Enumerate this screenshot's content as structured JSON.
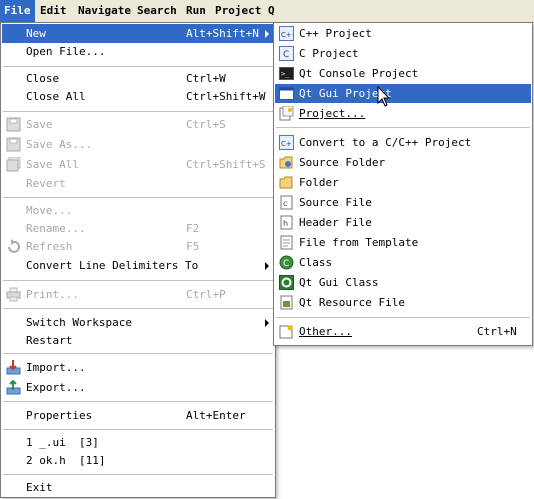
{
  "menubar": {
    "items": [
      {
        "label": "File"
      },
      {
        "label": "Edit"
      },
      {
        "label": "Navigate"
      },
      {
        "label": "Search"
      },
      {
        "label": "Run"
      },
      {
        "label": "Project"
      },
      {
        "label": "Q"
      }
    ]
  },
  "file_menu": {
    "new": {
      "label": "New",
      "accel": "Alt+Shift+N"
    },
    "open_file": {
      "label": "Open File..."
    },
    "close": {
      "label": "Close",
      "accel": "Ctrl+W"
    },
    "close_all": {
      "label": "Close All",
      "accel": "Ctrl+Shift+W"
    },
    "save": {
      "label": "Save",
      "accel": "Ctrl+S"
    },
    "save_as": {
      "label": "Save As..."
    },
    "save_all": {
      "label": "Save All",
      "accel": "Ctrl+Shift+S"
    },
    "revert": {
      "label": "Revert"
    },
    "move": {
      "label": "Move..."
    },
    "rename": {
      "label": "Rename...",
      "accel": "F2"
    },
    "refresh": {
      "label": "Refresh",
      "accel": "F5"
    },
    "convert_line_delimiters": {
      "label": "Convert Line Delimiters To"
    },
    "print": {
      "label": "Print...",
      "accel": "Ctrl+P"
    },
    "switch_workspace": {
      "label": "Switch Workspace"
    },
    "restart": {
      "label": "Restart"
    },
    "import": {
      "label": "Import..."
    },
    "export": {
      "label": "Export..."
    },
    "properties": {
      "label": "Properties",
      "accel": "Alt+Enter"
    },
    "recent_1": {
      "label": "1 _.ui  [3]"
    },
    "recent_2": {
      "label": "2 ok.h  [11]"
    },
    "exit": {
      "label": "Exit"
    }
  },
  "new_submenu": {
    "cpp_project": {
      "label": "C++ Project"
    },
    "c_project": {
      "label": "C Project"
    },
    "qt_console_project": {
      "label": "Qt Console Project"
    },
    "qt_gui_project": {
      "label": "Qt Gui Project"
    },
    "project": {
      "label": "Project..."
    },
    "convert_to_c_project": {
      "label": "Convert to a C/C++ Project"
    },
    "source_folder": {
      "label": "Source Folder"
    },
    "folder": {
      "label": "Folder"
    },
    "source_file": {
      "label": "Source File"
    },
    "header_file": {
      "label": "Header File"
    },
    "file_from_template": {
      "label": "File from Template"
    },
    "class": {
      "label": "Class"
    },
    "qt_gui_class": {
      "label": "Qt Gui Class"
    },
    "qt_resource_file": {
      "label": "Qt Resource File"
    },
    "other": {
      "label": "Other...",
      "accel": "Ctrl+N"
    }
  },
  "colors": {
    "menubar_bg": "#ece9d8",
    "highlight": "#316ac5",
    "disabled_text": "#a8a8a8"
  }
}
